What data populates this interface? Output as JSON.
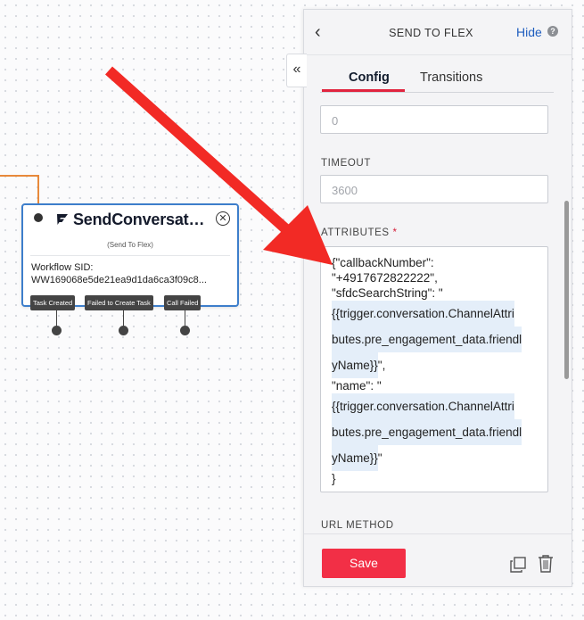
{
  "canvas": {
    "widget": {
      "title": "SendConversatio...",
      "subtitle": "(Send To Flex)",
      "sid_label": "Workflow SID:",
      "sid_value": "WW169068e5de21ea9d1da6ca3f09c8...",
      "transitions": [
        "Task Created",
        "Failed to Create Task",
        "Call Failed"
      ]
    }
  },
  "panel": {
    "title": "SEND TO FLEX",
    "hide_label": "Hide",
    "help_icon": "?",
    "back_icon": "chevron-left",
    "collapse_icon": "double-chevron-left",
    "tabs": [
      {
        "label": "Config",
        "active": true
      },
      {
        "label": "Transitions",
        "active": false
      }
    ],
    "fields": {
      "first_placeholder": "0",
      "timeout_label": "TIMEOUT",
      "timeout_placeholder": "3600",
      "attributes_label": "ATTRIBUTES",
      "attributes_required": "*",
      "attributes_lines": [
        "{\"callbackNumber\":",
        "\"+4917672822222\",",
        "\"sfdcSearchString\": \"",
        "{{trigger.conversation.ChannelAttri",
        "butes.pre_engagement_data.friendl",
        "yName}}",
        "\",",
        "\"name\": \"",
        "{{trigger.conversation.ChannelAttri",
        "butes.pre_engagement_data.friendl",
        "yName}}",
        "\"",
        "}"
      ],
      "url_method_label": "URL METHOD"
    },
    "footer": {
      "save_label": "Save",
      "copy_icon": "duplicate-icon",
      "delete_icon": "trash-icon"
    }
  },
  "colors": {
    "accent_red": "#f22f46",
    "widget_border": "#3d7ecb",
    "link_blue": "#1f5ebf",
    "connector_orange": "#e8893b",
    "highlight_blue": "#e4eef9"
  }
}
